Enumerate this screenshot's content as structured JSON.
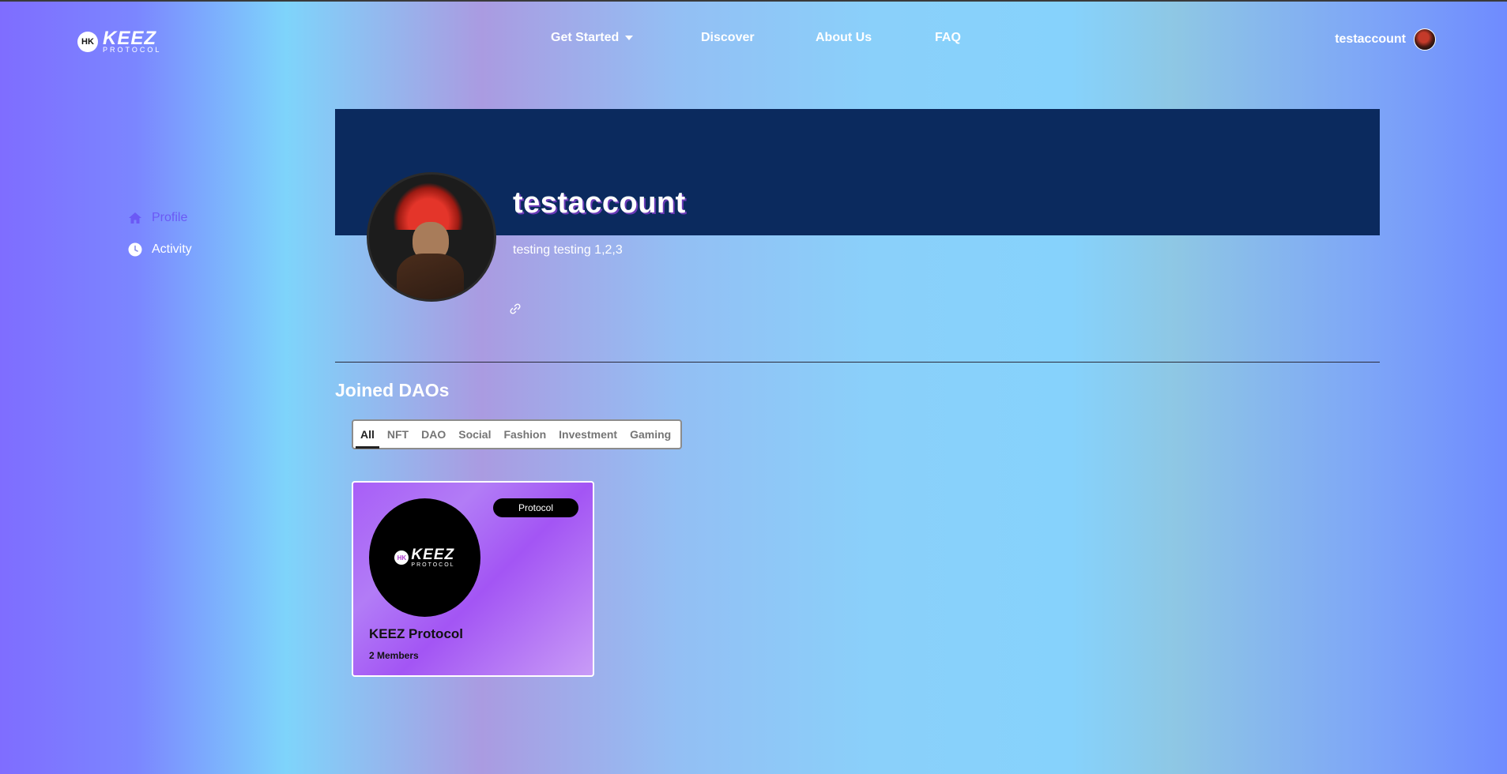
{
  "header": {
    "logo_badge": "HK",
    "logo_main": "KEEZ",
    "logo_sub": "PROTOCOL",
    "nav": {
      "get_started": "Get Started",
      "discover": "Discover",
      "about": "About Us",
      "faq": "FAQ"
    },
    "username": "testaccount"
  },
  "sidebar": {
    "items": [
      {
        "label": "Profile",
        "icon": "home-icon",
        "active": true
      },
      {
        "label": "Activity",
        "icon": "clock-icon",
        "active": false
      }
    ]
  },
  "profile": {
    "name": "testaccount",
    "bio": "testing testing 1,2,3"
  },
  "joined": {
    "title": "Joined DAOs",
    "tabs": [
      "All",
      "NFT",
      "DAO",
      "Social",
      "Fashion",
      "Investment",
      "Gaming"
    ],
    "active_tab": "All",
    "cards": [
      {
        "logo_badge": "HK",
        "logo_main": "KEEZ",
        "logo_sub": "PROTOCOL",
        "tag": "Protocol",
        "name": "KEEZ Protocol",
        "members": "2 Members"
      }
    ]
  },
  "colors": {
    "banner": "#0b2a5e",
    "active_sidebar": "#6b59f5",
    "card_purple": "#a855f7"
  }
}
